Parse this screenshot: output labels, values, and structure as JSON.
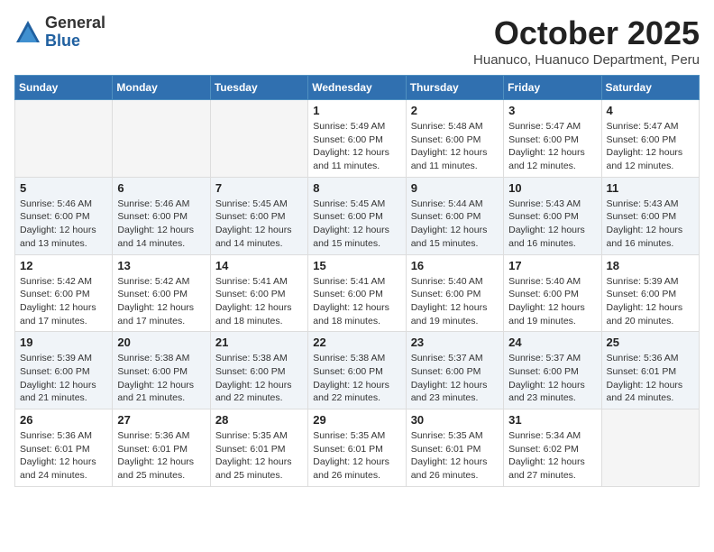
{
  "logo": {
    "general": "General",
    "blue": "Blue"
  },
  "title": "October 2025",
  "subtitle": "Huanuco, Huanuco Department, Peru",
  "days_of_week": [
    "Sunday",
    "Monday",
    "Tuesday",
    "Wednesday",
    "Thursday",
    "Friday",
    "Saturday"
  ],
  "weeks": [
    {
      "days": [
        {
          "num": "",
          "info": ""
        },
        {
          "num": "",
          "info": ""
        },
        {
          "num": "",
          "info": ""
        },
        {
          "num": "1",
          "info": "Sunrise: 5:49 AM\nSunset: 6:00 PM\nDaylight: 12 hours\nand 11 minutes."
        },
        {
          "num": "2",
          "info": "Sunrise: 5:48 AM\nSunset: 6:00 PM\nDaylight: 12 hours\nand 11 minutes."
        },
        {
          "num": "3",
          "info": "Sunrise: 5:47 AM\nSunset: 6:00 PM\nDaylight: 12 hours\nand 12 minutes."
        },
        {
          "num": "4",
          "info": "Sunrise: 5:47 AM\nSunset: 6:00 PM\nDaylight: 12 hours\nand 12 minutes."
        }
      ]
    },
    {
      "days": [
        {
          "num": "5",
          "info": "Sunrise: 5:46 AM\nSunset: 6:00 PM\nDaylight: 12 hours\nand 13 minutes."
        },
        {
          "num": "6",
          "info": "Sunrise: 5:46 AM\nSunset: 6:00 PM\nDaylight: 12 hours\nand 14 minutes."
        },
        {
          "num": "7",
          "info": "Sunrise: 5:45 AM\nSunset: 6:00 PM\nDaylight: 12 hours\nand 14 minutes."
        },
        {
          "num": "8",
          "info": "Sunrise: 5:45 AM\nSunset: 6:00 PM\nDaylight: 12 hours\nand 15 minutes."
        },
        {
          "num": "9",
          "info": "Sunrise: 5:44 AM\nSunset: 6:00 PM\nDaylight: 12 hours\nand 15 minutes."
        },
        {
          "num": "10",
          "info": "Sunrise: 5:43 AM\nSunset: 6:00 PM\nDaylight: 12 hours\nand 16 minutes."
        },
        {
          "num": "11",
          "info": "Sunrise: 5:43 AM\nSunset: 6:00 PM\nDaylight: 12 hours\nand 16 minutes."
        }
      ]
    },
    {
      "days": [
        {
          "num": "12",
          "info": "Sunrise: 5:42 AM\nSunset: 6:00 PM\nDaylight: 12 hours\nand 17 minutes."
        },
        {
          "num": "13",
          "info": "Sunrise: 5:42 AM\nSunset: 6:00 PM\nDaylight: 12 hours\nand 17 minutes."
        },
        {
          "num": "14",
          "info": "Sunrise: 5:41 AM\nSunset: 6:00 PM\nDaylight: 12 hours\nand 18 minutes."
        },
        {
          "num": "15",
          "info": "Sunrise: 5:41 AM\nSunset: 6:00 PM\nDaylight: 12 hours\nand 18 minutes."
        },
        {
          "num": "16",
          "info": "Sunrise: 5:40 AM\nSunset: 6:00 PM\nDaylight: 12 hours\nand 19 minutes."
        },
        {
          "num": "17",
          "info": "Sunrise: 5:40 AM\nSunset: 6:00 PM\nDaylight: 12 hours\nand 19 minutes."
        },
        {
          "num": "18",
          "info": "Sunrise: 5:39 AM\nSunset: 6:00 PM\nDaylight: 12 hours\nand 20 minutes."
        }
      ]
    },
    {
      "days": [
        {
          "num": "19",
          "info": "Sunrise: 5:39 AM\nSunset: 6:00 PM\nDaylight: 12 hours\nand 21 minutes."
        },
        {
          "num": "20",
          "info": "Sunrise: 5:38 AM\nSunset: 6:00 PM\nDaylight: 12 hours\nand 21 minutes."
        },
        {
          "num": "21",
          "info": "Sunrise: 5:38 AM\nSunset: 6:00 PM\nDaylight: 12 hours\nand 22 minutes."
        },
        {
          "num": "22",
          "info": "Sunrise: 5:38 AM\nSunset: 6:00 PM\nDaylight: 12 hours\nand 22 minutes."
        },
        {
          "num": "23",
          "info": "Sunrise: 5:37 AM\nSunset: 6:00 PM\nDaylight: 12 hours\nand 23 minutes."
        },
        {
          "num": "24",
          "info": "Sunrise: 5:37 AM\nSunset: 6:00 PM\nDaylight: 12 hours\nand 23 minutes."
        },
        {
          "num": "25",
          "info": "Sunrise: 5:36 AM\nSunset: 6:01 PM\nDaylight: 12 hours\nand 24 minutes."
        }
      ]
    },
    {
      "days": [
        {
          "num": "26",
          "info": "Sunrise: 5:36 AM\nSunset: 6:01 PM\nDaylight: 12 hours\nand 24 minutes."
        },
        {
          "num": "27",
          "info": "Sunrise: 5:36 AM\nSunset: 6:01 PM\nDaylight: 12 hours\nand 25 minutes."
        },
        {
          "num": "28",
          "info": "Sunrise: 5:35 AM\nSunset: 6:01 PM\nDaylight: 12 hours\nand 25 minutes."
        },
        {
          "num": "29",
          "info": "Sunrise: 5:35 AM\nSunset: 6:01 PM\nDaylight: 12 hours\nand 26 minutes."
        },
        {
          "num": "30",
          "info": "Sunrise: 5:35 AM\nSunset: 6:01 PM\nDaylight: 12 hours\nand 26 minutes."
        },
        {
          "num": "31",
          "info": "Sunrise: 5:34 AM\nSunset: 6:02 PM\nDaylight: 12 hours\nand 27 minutes."
        },
        {
          "num": "",
          "info": ""
        }
      ]
    }
  ]
}
